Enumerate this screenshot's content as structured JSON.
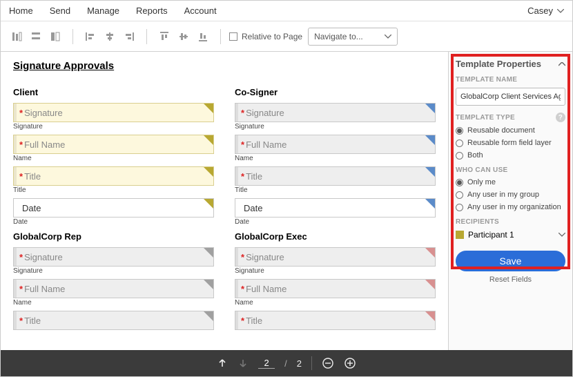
{
  "nav": {
    "items": [
      "Home",
      "Send",
      "Manage",
      "Reports",
      "Account"
    ],
    "user": "Casey"
  },
  "toolbar": {
    "relative": "Relative to Page",
    "navigate": "Navigate to..."
  },
  "doc": {
    "sectionTitle": "Signature Approvals",
    "groups": [
      {
        "title": "Client",
        "tone": "yellow",
        "flag": "y",
        "fields": [
          {
            "ph": "Signature",
            "req": true,
            "lbl": "Signature"
          },
          {
            "ph": "Full Name",
            "req": true,
            "lbl": "Name"
          },
          {
            "ph": "Title",
            "req": true,
            "lbl": "Title"
          },
          {
            "ph": "Date",
            "req": false,
            "lbl": "Date",
            "tone": "white"
          }
        ]
      },
      {
        "title": "Co-Signer",
        "tone": "grey",
        "flag": "b",
        "fields": [
          {
            "ph": "Signature",
            "req": true,
            "lbl": "Signature"
          },
          {
            "ph": "Full Name",
            "req": true,
            "lbl": "Name"
          },
          {
            "ph": "Title",
            "req": true,
            "lbl": "Title"
          },
          {
            "ph": "Date",
            "req": false,
            "lbl": "Date",
            "tone": "white"
          }
        ]
      },
      {
        "title": "GlobalCorp Rep",
        "tone": "grey",
        "flag": "g",
        "fields": [
          {
            "ph": "Signature",
            "req": true,
            "lbl": "Signature"
          },
          {
            "ph": "Full Name",
            "req": true,
            "lbl": "Name"
          },
          {
            "ph": "Title",
            "req": true,
            "lbl": ""
          }
        ]
      },
      {
        "title": "GlobalCorp Exec",
        "tone": "grey",
        "flag": "p",
        "fields": [
          {
            "ph": "Signature",
            "req": true,
            "lbl": "Signature"
          },
          {
            "ph": "Full Name",
            "req": true,
            "lbl": "Name"
          },
          {
            "ph": "Title",
            "req": true,
            "lbl": ""
          }
        ]
      }
    ]
  },
  "panel": {
    "title": "Template Properties",
    "name_label": "TEMPLATE NAME",
    "name_value": "GlobalCorp Client Services Agreement",
    "type_label": "TEMPLATE TYPE",
    "type_opts": [
      "Reusable document",
      "Reusable form field layer",
      "Both"
    ],
    "type_sel": 0,
    "who_label": "WHO CAN USE",
    "who_opts": [
      "Only me",
      "Any user in my group",
      "Any user in my organization"
    ],
    "who_sel": 0,
    "recip_label": "RECIPIENTS",
    "recip1": "Participant 1",
    "save": "Save",
    "reset": "Reset Fields"
  },
  "pager": {
    "cur": "2",
    "total": "2"
  }
}
